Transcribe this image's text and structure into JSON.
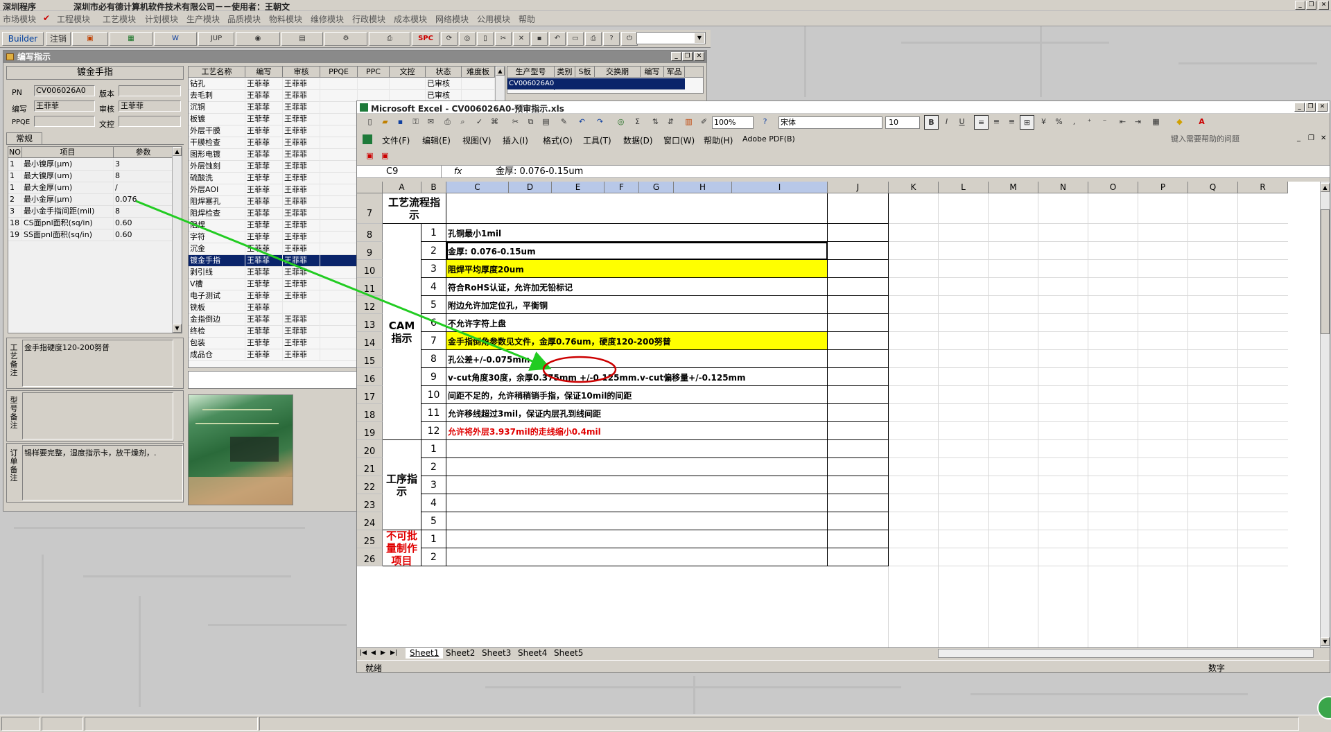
{
  "app": {
    "title_left": "深圳程序",
    "title_main": "深圳市必有德计算机软件技术有限公司－－使用者：王朝文",
    "menu": [
      "市场模块",
      "工程模块",
      "工艺模块",
      "计划模块",
      "生产模块",
      "品质模块",
      "物料模块",
      "维修模块",
      "行政模块",
      "成本模块",
      "网络模块",
      "公用模块",
      "帮助"
    ],
    "toolbar": {
      "builder": "Builder",
      "logout": "注销",
      "jup": "JUP",
      "spc": "SPC"
    }
  },
  "left_panel": {
    "title": "编写指示",
    "header": "镀金手指",
    "fields": {
      "pn_label": "PN",
      "pn_value": "CV006026A0",
      "version_label": "版本",
      "version_value": "",
      "writer_label": "编写",
      "writer_value": "王菲菲",
      "review_label": "审核",
      "review_value": "王菲菲",
      "ppqe_label": "PPQE",
      "ppqe_value": "",
      "wenkong_label": "文控",
      "wenkong_value": ""
    },
    "tab": "常规",
    "param_headers": [
      "NO",
      "项目",
      "参数"
    ],
    "params": [
      {
        "no": "1",
        "item": "最小镍厚(μm)",
        "value": "3"
      },
      {
        "no": "1",
        "item": "最大镍厚(um)",
        "value": "8"
      },
      {
        "no": "1",
        "item": "最大金厚(um)",
        "value": "/"
      },
      {
        "no": "2",
        "item": "最小金厚(μm)",
        "value": "0.076"
      },
      {
        "no": "3",
        "item": "最小金手指间距(mil)",
        "value": "8"
      },
      {
        "no": "18",
        "item": "CS面pnl面积(sq/in)",
        "value": "0.60"
      },
      {
        "no": "19",
        "item": "SS面pnl面积(sq/in)",
        "value": "0.60"
      }
    ],
    "memo1_label": "工艺备注",
    "memo1_text": "金手指硬度120-200努普",
    "memo2_label": "型号备注",
    "memo2_text": "",
    "memo3_label": "订单备注",
    "memo3_text": "锡样要完整，湿度指示卡，放干燥剂，."
  },
  "process_grid": {
    "headers": [
      "工艺名称",
      "编写",
      "审核",
      "PPQE",
      "PPC",
      "文控",
      "状态",
      "难度板"
    ],
    "rows": [
      {
        "name": "钻孔",
        "w": "王菲菲",
        "r": "王菲菲",
        "status": "已审核"
      },
      {
        "name": "去毛刺",
        "w": "王菲菲",
        "r": "王菲菲",
        "status": "已审核"
      },
      {
        "name": "沉铜",
        "w": "王菲菲",
        "r": "王菲菲",
        "status": ""
      },
      {
        "name": "板镀",
        "w": "王菲菲",
        "r": "王菲菲",
        "status": ""
      },
      {
        "name": "外层干膜",
        "w": "王菲菲",
        "r": "王菲菲",
        "status": ""
      },
      {
        "name": "干膜检查",
        "w": "王菲菲",
        "r": "王菲菲",
        "status": ""
      },
      {
        "name": "图形电镀",
        "w": "王菲菲",
        "r": "王菲菲",
        "status": ""
      },
      {
        "name": "外层蚀刻",
        "w": "王菲菲",
        "r": "王菲菲",
        "status": ""
      },
      {
        "name": "硫酸洗",
        "w": "王菲菲",
        "r": "王菲菲",
        "status": ""
      },
      {
        "name": "外层AOI",
        "w": "王菲菲",
        "r": "王菲菲",
        "status": ""
      },
      {
        "name": "阻焊塞孔",
        "w": "王菲菲",
        "r": "王菲菲",
        "status": ""
      },
      {
        "name": "阻焊检查",
        "w": "王菲菲",
        "r": "王菲菲",
        "status": ""
      },
      {
        "name": "阻焊",
        "w": "王菲菲",
        "r": "王菲菲",
        "status": ""
      },
      {
        "name": "字符",
        "w": "王菲菲",
        "r": "王菲菲",
        "status": ""
      },
      {
        "name": "沉金",
        "w": "王菲菲",
        "r": "王菲菲",
        "status": ""
      },
      {
        "name": "镀金手指",
        "w": "王菲菲",
        "r": "王菲菲",
        "status": ""
      },
      {
        "name": "剥引线",
        "w": "王菲菲",
        "r": "王菲菲",
        "status": ""
      },
      {
        "name": "V槽",
        "w": "王菲菲",
        "r": "王菲菲",
        "status": ""
      },
      {
        "name": "电子测试",
        "w": "王菲菲",
        "r": "王菲菲",
        "status": ""
      },
      {
        "name": "铣板",
        "w": "王菲菲",
        "r": "",
        "status": ""
      },
      {
        "name": "金指倒边",
        "w": "王菲菲",
        "r": "王菲菲",
        "status": ""
      },
      {
        "name": "终检",
        "w": "王菲菲",
        "r": "王菲菲",
        "status": ""
      },
      {
        "name": "包装",
        "w": "王菲菲",
        "r": "王菲菲",
        "status": ""
      },
      {
        "name": "成品仓",
        "w": "王菲菲",
        "r": "王菲菲",
        "status": ""
      }
    ]
  },
  "model_grid": {
    "headers": [
      "生产型号",
      "类别",
      "S板",
      "交换期",
      "编写",
      "军品"
    ],
    "selected": "CV006026A0"
  },
  "excel": {
    "title": "Microsoft Excel - CV006026A0-预审指示.xls",
    "menu": [
      "文件(F)",
      "编辑(E)",
      "视图(V)",
      "插入(I)",
      "格式(O)",
      "工具(T)",
      "数据(D)",
      "窗口(W)",
      "帮助(H)",
      "Adobe PDF(B)"
    ],
    "help_placeholder": "键入需要帮助的问题",
    "zoom": "100%",
    "font": "宋体",
    "size": "10",
    "name_box": "C9",
    "fx": "fx",
    "formula": "金厚: 0.076-0.15um",
    "columns": [
      "A",
      "B",
      "C",
      "D",
      "E",
      "F",
      "G",
      "H",
      "I",
      "J",
      "K",
      "L",
      "M",
      "N",
      "O",
      "P",
      "Q",
      "R"
    ],
    "process_flow_label": "工艺流程指示",
    "cam_label": "CAM指示",
    "step_label": "工序指示",
    "nobatch_label": "不可批量制作项目",
    "rows": [
      {
        "row": "7",
        "num": "",
        "text": ""
      },
      {
        "row": "8",
        "num": "1",
        "text": "孔铜最小1mil"
      },
      {
        "row": "9",
        "num": "2",
        "text": "金厚: 0.076-0.15um"
      },
      {
        "row": "10",
        "num": "3",
        "text": "阻焊平均厚度20um"
      },
      {
        "row": "11",
        "num": "4",
        "text": "符合RoHS认证，允许加无铅标记"
      },
      {
        "row": "12",
        "num": "5",
        "text": "附边允许加定位孔，平衡铜"
      },
      {
        "row": "13",
        "num": "6",
        "text": "不允许字符上盘"
      },
      {
        "row": "14",
        "num": "7",
        "text": "金手指倒角参数见文件，金厚0.76um，硬度120-200努普"
      },
      {
        "row": "15",
        "num": "8",
        "text": "孔公差+/-0.075mm"
      },
      {
        "row": "16",
        "num": "9",
        "text": "v-cut角度30度，余厚0.375mm +/-0.125mm.v-cut偏移量+/-0.125mm"
      },
      {
        "row": "17",
        "num": "10",
        "text": "间距不足的，允许稍稍销手指，保证10mil的间距"
      },
      {
        "row": "18",
        "num": "11",
        "text": "允许移线超过3mil，保证内层孔到线间距"
      },
      {
        "row": "19",
        "num": "12",
        "text": "允许将外层3.937mil的走线缩小0.4mil"
      },
      {
        "row": "20",
        "num": "1",
        "text": ""
      },
      {
        "row": "21",
        "num": "2",
        "text": ""
      },
      {
        "row": "22",
        "num": "3",
        "text": ""
      },
      {
        "row": "23",
        "num": "4",
        "text": ""
      },
      {
        "row": "24",
        "num": "5",
        "text": ""
      },
      {
        "row": "25",
        "num": "1",
        "text": ""
      },
      {
        "row": "26",
        "num": "2",
        "text": ""
      }
    ],
    "sheets": [
      "Sheet1",
      "Sheet2",
      "Sheet3",
      "Sheet4",
      "Sheet5"
    ],
    "status_left": "就绪",
    "status_right": "数字"
  },
  "colors": {
    "highlight": "#ffff00",
    "selection": "#0a246a",
    "arrow": "#22cc22",
    "circle": "#cc0000",
    "red_text": "#e00000"
  }
}
